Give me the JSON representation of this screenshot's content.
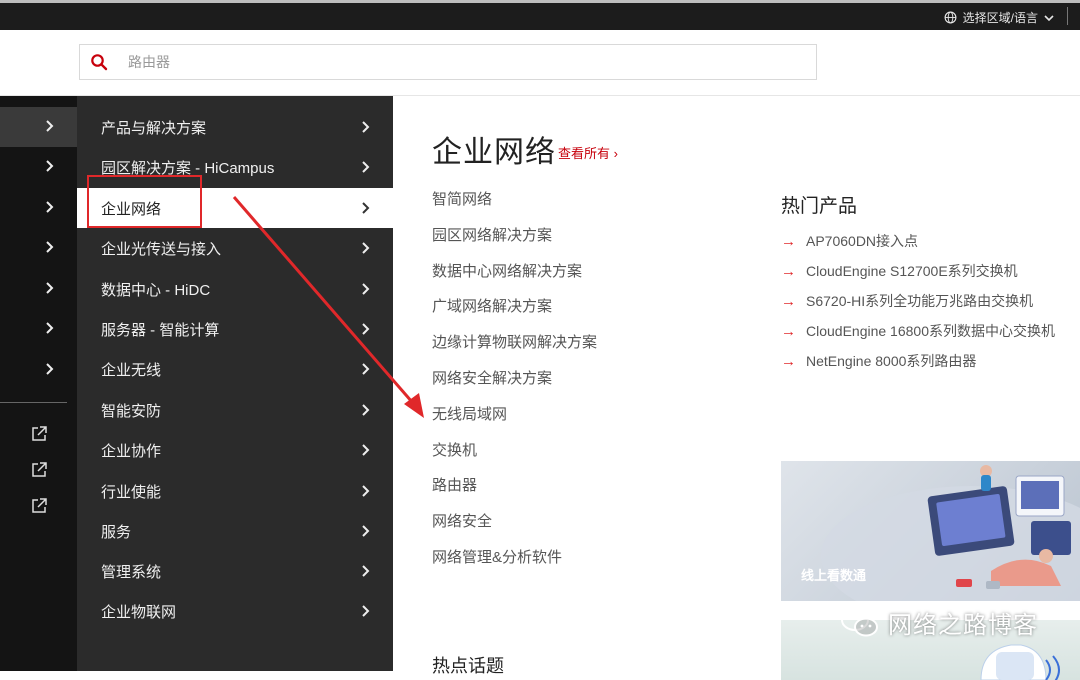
{
  "topbar": {
    "region_label": "选择区域/语言"
  },
  "search": {
    "placeholder": "路由器"
  },
  "nav": {
    "items": [
      {
        "label": "产品与解决方案"
      },
      {
        "label": "园区解决方案 - HiCampus"
      },
      {
        "label": "企业网络"
      },
      {
        "label": "企业光传送与接入"
      },
      {
        "label": "数据中心 - HiDC"
      },
      {
        "label": "服务器 - 智能计算"
      },
      {
        "label": "企业无线"
      },
      {
        "label": "智能安防"
      },
      {
        "label": "企业协作"
      },
      {
        "label": "行业使能"
      },
      {
        "label": "服务"
      },
      {
        "label": "管理系统"
      },
      {
        "label": "企业物联网"
      }
    ],
    "active_index": 2
  },
  "main": {
    "title": "企业网络",
    "view_all": "查看所有 ›",
    "links": [
      "智简网络",
      "园区网络解决方案",
      "数据中心网络解决方案",
      "广域网络解决方案",
      "边缘计算物联网解决方案",
      "网络安全解决方案",
      "无线局域网",
      "交换机",
      "路由器",
      "网络安全",
      "网络管理&分析软件"
    ],
    "hot_title": "热门产品",
    "hot_products": [
      "AP7060DN接入点",
      "CloudEngine S12700E系列交换机",
      "S6720-HI系列全功能万兆路由交换机",
      "CloudEngine 16800系列数据中心交换机",
      "NetEngine 8000系列路由器"
    ],
    "banner_text": "线上看数通",
    "hot_topics": "热点话题"
  },
  "watermark": "网络之路博客",
  "colors": {
    "accent": "#c7000b",
    "annotation": "#e0282a",
    "menu_bg": "#2b2b2b",
    "rail_bg": "#141414",
    "topbar_bg": "#1c1c1c"
  },
  "icons": [
    "globe-icon",
    "chevron-down-icon",
    "search-icon",
    "chevron-right-icon",
    "external-link-icon",
    "arrow-right-icon",
    "wechat-icon"
  ]
}
